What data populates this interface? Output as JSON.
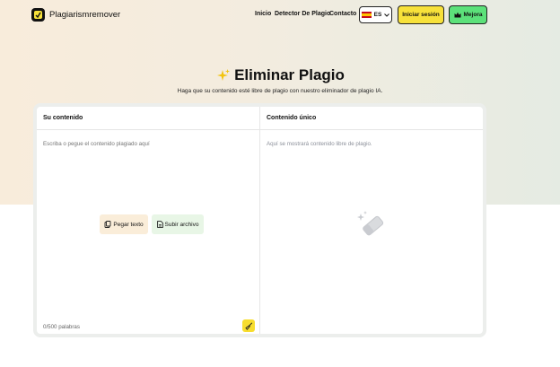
{
  "header": {
    "brand": "Plagiarismremover",
    "nav": [
      {
        "label": "Inicio"
      },
      {
        "label": "Detector De Plagio"
      },
      {
        "label": "Contacto"
      }
    ],
    "language": "ES",
    "login_label": "Iniciar sesión",
    "upgrade_label": "Mejora"
  },
  "hero": {
    "title": "Eliminar Plagio",
    "subtitle": "Haga que su contenido esté libre de plagio con nuestro eliminador de plagio IA."
  },
  "editor": {
    "input_heading": "Su contenido",
    "input_placeholder": "Escriba o pegue el contenido plagiado aquí",
    "paste_label": "Pegar texto",
    "upload_label": "Subir archivo",
    "word_count": "0/500 palabras",
    "output_heading": "Contenido único",
    "output_placeholder": "Aquí se mostrará contenido libre de plagio."
  },
  "colors": {
    "login_bg": "#f7e13a",
    "upgrade_bg": "#5ce17a",
    "paste_bg": "#faedd9",
    "upload_bg": "#e8f6e6",
    "accent": "#f7dd2e"
  },
  "icons": [
    "logo-icon",
    "spain-flag-icon",
    "chevron-down-icon",
    "crown-icon",
    "sparkle-icon",
    "clipboard-icon",
    "file-icon",
    "broom-icon",
    "eraser-sparkle-icon"
  ]
}
